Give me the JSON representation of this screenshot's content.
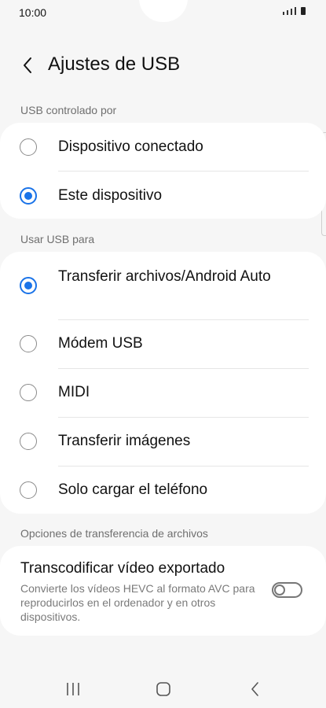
{
  "status_bar": {
    "time": "10:00"
  },
  "header": {
    "title": "Ajustes de USB"
  },
  "usb_controlled_by": {
    "label": "USB controlado por",
    "options": [
      {
        "label": "Dispositivo conectado",
        "selected": false
      },
      {
        "label": "Este dispositivo",
        "selected": true
      }
    ]
  },
  "use_usb_for": {
    "label": "Usar USB para",
    "options": [
      {
        "label": "Transferir archivos/Android Auto",
        "selected": true
      },
      {
        "label": "Módem USB",
        "selected": false
      },
      {
        "label": "MIDI",
        "selected": false
      },
      {
        "label": "Transferir imágenes",
        "selected": false
      },
      {
        "label": "Solo cargar el teléfono",
        "selected": false
      }
    ]
  },
  "file_transfer_options": {
    "label": "Opciones de transferencia de archivos",
    "transcode": {
      "title": "Transcodificar vídeo exportado",
      "description": "Convierte los vídeos HEVC al formato AVC para reproducirlos en el ordenador y en otros dispositivos.",
      "enabled": false
    }
  },
  "colors": {
    "accent": "#1a73e8",
    "background": "#f6f6f6",
    "card": "#ffffff"
  },
  "icons": {
    "back": "back-arrow-icon",
    "recents": "recents-icon",
    "home": "home-icon",
    "nav_back": "nav-back-icon"
  }
}
